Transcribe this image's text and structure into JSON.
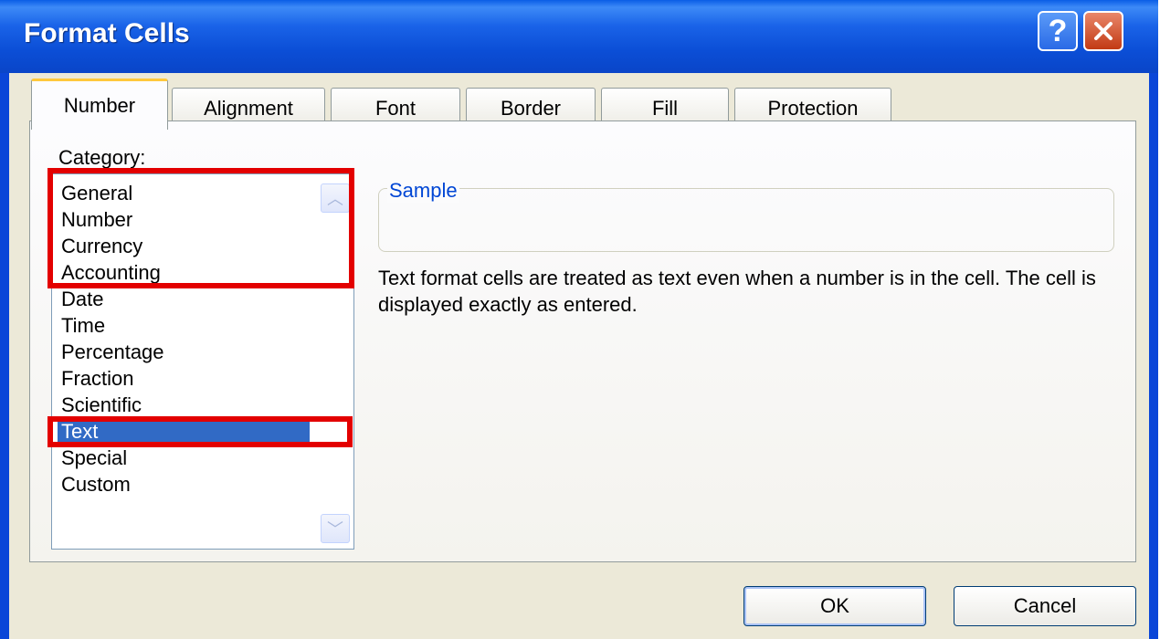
{
  "dialog": {
    "title": "Format Cells",
    "help_glyph": "?",
    "close_glyph": "✕"
  },
  "tabs": [
    {
      "label": "Number",
      "active": true
    },
    {
      "label": "Alignment"
    },
    {
      "label": "Font"
    },
    {
      "label": "Border"
    },
    {
      "label": "Fill"
    },
    {
      "label": "Protection"
    }
  ],
  "category": {
    "label": "Category:",
    "items": [
      "General",
      "Number",
      "Currency",
      "Accounting",
      "Date",
      "Time",
      "Percentage",
      "Fraction",
      "Scientific",
      "Text",
      "Special",
      "Custom"
    ],
    "selected": "Text"
  },
  "sample": {
    "label": "Sample",
    "value": ""
  },
  "description": "Text format cells are treated as text even when a number is in the cell.  The cell is displayed exactly as entered.",
  "buttons": {
    "ok": "OK",
    "cancel": "Cancel"
  },
  "scrollbar": {
    "up_glyph": "︿",
    "down_glyph": "﹀"
  },
  "colors": {
    "title_bar": "#0a4ed6",
    "selection": "#316ac5",
    "highlight_box": "#e30000",
    "sample_label": "#0046d5"
  }
}
